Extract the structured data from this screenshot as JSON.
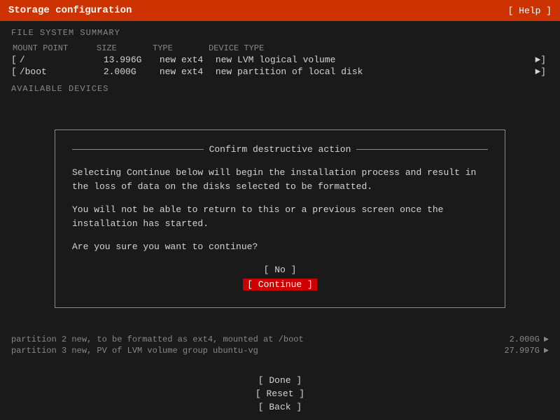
{
  "titlebar": {
    "title": "Storage configuration",
    "help_label": "[ Help ]"
  },
  "fs_summary": {
    "header": "FILE SYSTEM SUMMARY",
    "columns": {
      "mount": "MOUNT POINT",
      "size": "SIZE",
      "type": "TYPE",
      "device": "DEVICE TYPE"
    },
    "rows": [
      {
        "mount": "/",
        "size": "13.996G",
        "type": "new ext4",
        "device": "new LVM logical volume"
      },
      {
        "mount": "/boot",
        "size": "2.000G",
        "type": "new ext4",
        "device": "new partition of local disk"
      }
    ]
  },
  "available": {
    "header": "AVAILABLE DEVICES"
  },
  "modal": {
    "title": "Confirm destructive action",
    "paragraph1": "Selecting Continue below will begin the installation process and result in the loss of data on the disks selected to be formatted.",
    "paragraph2": "You will not be able to return to this or a previous screen once the installation has started.",
    "paragraph3": "Are you sure you want to continue?",
    "btn_no": "[ No       ]",
    "btn_continue": "[ Continue ]"
  },
  "bottom_info": {
    "rows": [
      {
        "left": "partition 2  new, to be formatted as ext4, mounted at /boot",
        "size": "2.000G",
        "arrow": "►"
      },
      {
        "left": "partition 3  new, PV of LVM volume group ubuntu-vg",
        "size": "27.997G",
        "arrow": "►"
      }
    ]
  },
  "footer": {
    "done_label": "[ Done  ]",
    "reset_label": "[ Reset ]",
    "back_label": "[ Back  ]"
  }
}
